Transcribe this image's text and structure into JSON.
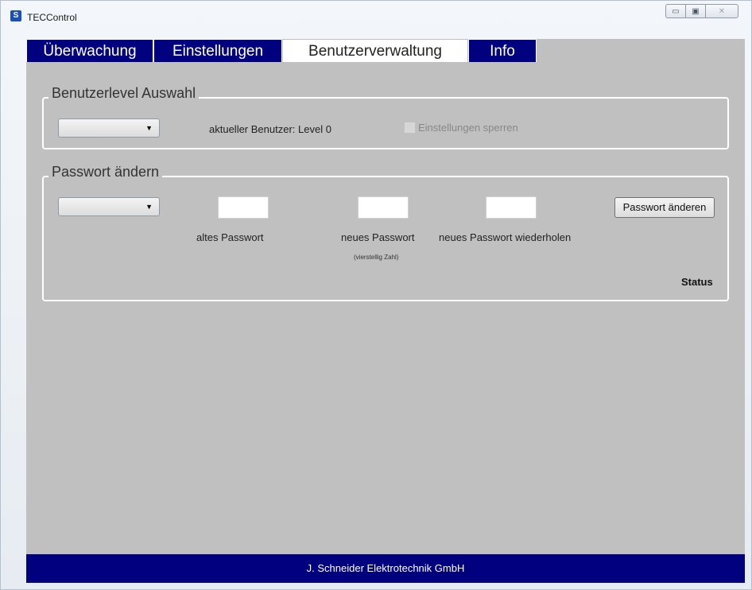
{
  "window": {
    "title": "TECControl",
    "app_icon_glyph": "S",
    "controls": [
      "▭",
      "▣",
      "✕"
    ]
  },
  "tabs": [
    {
      "label": "Überwachung",
      "active": false
    },
    {
      "label": "Einstellungen",
      "active": false
    },
    {
      "label": "Benutzerverwaltung",
      "active": true
    },
    {
      "label": "Info",
      "active": false
    }
  ],
  "benutzerlevel": {
    "title": "Benutzerlevel Auswahl",
    "select_value": "",
    "current_user_label": "aktueller Benutzer: Level 0",
    "lock_settings_label": "Einstellungen sperren",
    "lock_settings_checked": false,
    "lock_settings_enabled": false
  },
  "passwort": {
    "title": "Passwort ändern",
    "select_value": "",
    "old_password_label": "altes Passwort",
    "new_password_label": "neues Passwort",
    "new_password_hint": "(vierstellig Zahl)",
    "repeat_password_label": "neues Passwort wiederholen",
    "change_button_label": "Passwort änderen",
    "status_label": "Status"
  },
  "footer": {
    "text": "J. Schneider Elektrotechnik GmbH"
  },
  "colors": {
    "navy": "#010180",
    "panel_bg": "#c0c0c0",
    "group_border": "#ffffff"
  }
}
